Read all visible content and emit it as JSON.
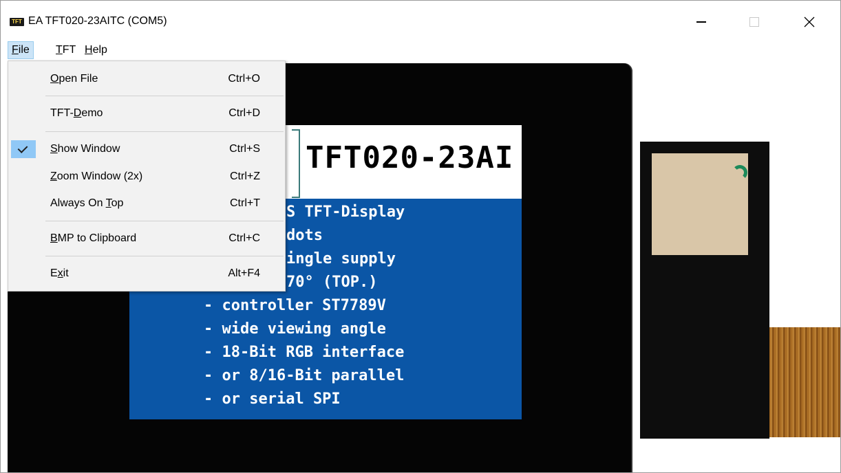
{
  "window": {
    "title": "EA TFT020-23AITC (COM5)",
    "icon_text": "TFT"
  },
  "menubar": {
    "file": {
      "accel": "F",
      "rest": "ile"
    },
    "tft": {
      "accel": "T",
      "rest": "FT"
    },
    "help": {
      "accel": "H",
      "rest": "elp"
    }
  },
  "file_menu": {
    "open": {
      "accel": "O",
      "rest": "pen File",
      "shortcut": "Ctrl+O"
    },
    "demo": {
      "pre": "TFT-",
      "accel": "D",
      "rest": "emo",
      "shortcut": "Ctrl+D"
    },
    "show": {
      "accel": "S",
      "rest": "how Window",
      "shortcut": "Ctrl+S",
      "checked": true
    },
    "zoom": {
      "accel": "Z",
      "rest": "oom Window (2x)",
      "shortcut": "Ctrl+Z"
    },
    "top": {
      "pre": "Always On ",
      "accel": "T",
      "rest": "op",
      "shortcut": "Ctrl+T"
    },
    "bmp": {
      "accel": "B",
      "rest": "MP to Clipboard",
      "shortcut": "Ctrl+C"
    },
    "exit": {
      "pre": "E",
      "accel": "x",
      "rest": "it",
      "shortcut": "Alt+F4"
    }
  },
  "display": {
    "title": "TFT020-23AI",
    "lines": [
      "S TFT-Display",
      " dots",
      "ingle supply",
      "70° (TOP.)",
      "- controller ST7789V",
      "- wide viewing angle",
      "- 18-Bit RGB interface",
      "- or 8/16-Bit parallel",
      "- or serial SPI"
    ]
  },
  "colors": {
    "screen_blue": "#0b56a6",
    "menu_highlight": "#cce4f7",
    "check_bg": "#90c8f6"
  }
}
